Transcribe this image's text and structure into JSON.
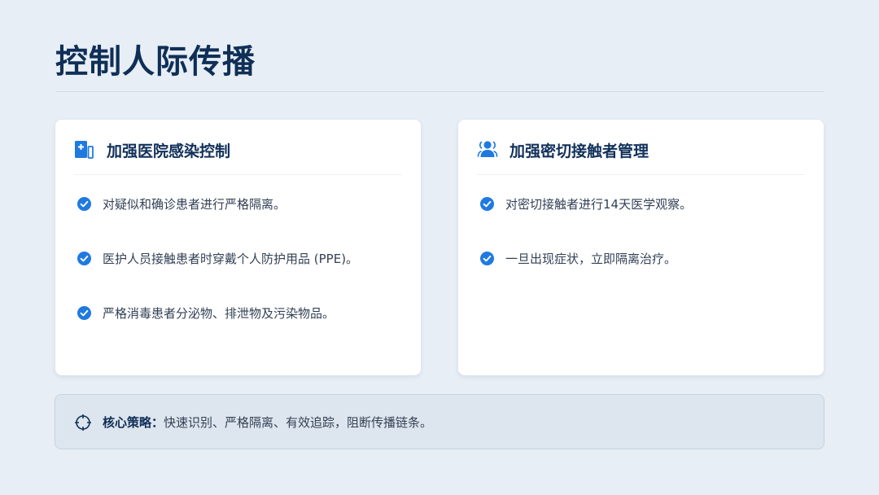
{
  "page": {
    "title": "控制人际传播"
  },
  "cards": [
    {
      "title": "加强医院感染控制",
      "icon": "hospital-icon",
      "items": [
        "对疑似和确诊患者进行严格隔离。",
        "医护人员接触患者时穿戴个人防护用品 (PPE)。",
        "严格消毒患者分泌物、排泄物及污染物品。"
      ]
    },
    {
      "title": "加强密切接触者管理",
      "icon": "people-icon",
      "items": [
        "对密切接触者进行14天医学观察。",
        "一旦出现症状，立即隔离治疗。"
      ]
    }
  ],
  "strategy": {
    "label": "核心策略：",
    "text": "快速识别、严格隔离、有效追踪，阻断传播链条。",
    "icon": "crosshair-icon"
  },
  "colors": {
    "background": "#e8eef5",
    "title": "#0f2f57",
    "accent": "#1f7ae0",
    "card": "#ffffff",
    "banner": "#dde5ee"
  }
}
